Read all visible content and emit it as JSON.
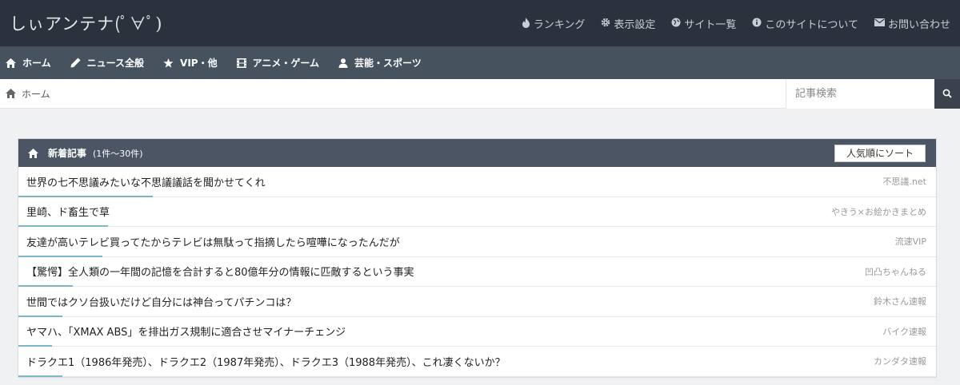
{
  "header": {
    "logo": "しぃアンテナ(ﾟ∀ﾟ)",
    "links": [
      {
        "label": "ランキング",
        "icon": "fire-icon"
      },
      {
        "label": "表示設定",
        "icon": "gear-icon"
      },
      {
        "label": "サイト一覧",
        "icon": "globe-icon"
      },
      {
        "label": "このサイトについて",
        "icon": "info-icon"
      },
      {
        "label": "お問い合わせ",
        "icon": "mail-icon"
      }
    ]
  },
  "nav": {
    "items": [
      {
        "label": "ホーム",
        "icon": "home-icon"
      },
      {
        "label": "ニュース全般",
        "icon": "pencil-icon"
      },
      {
        "label": "VIP・他",
        "icon": "star-icon"
      },
      {
        "label": "アニメ・ゲーム",
        "icon": "film-icon"
      },
      {
        "label": "芸能・スポーツ",
        "icon": "user-icon"
      }
    ]
  },
  "breadcrumb": {
    "home": "ホーム"
  },
  "search": {
    "placeholder": "記事検索"
  },
  "panel": {
    "title": "新着記事",
    "range": "(1件～30件)",
    "sort_label": "人気順にソート"
  },
  "articles": [
    {
      "title": "世界の七不思議みたいな不思議議話を聞かせてくれ",
      "site": "不思議.net"
    },
    {
      "title": "里崎、ド畜生で草",
      "site": "やきう×お絵かきまとめ"
    },
    {
      "title": "友達が高いテレビ買ってたからテレビは無駄って指摘したら喧嘩になったんだが",
      "site": "流速VIP"
    },
    {
      "title": "【驚愕】全人類の一年間の記憶を合計すると80億年分の情報に匹敵するという事実",
      "site": "凹凸ちゃんねる"
    },
    {
      "title": "世間ではクソ台扱いだけど自分には神台ってパチンコは？",
      "site": "鈴木さん速報"
    },
    {
      "title": "ヤマハ、「XMAX ABS」を排出ガス規制に適合させマイナーチェンジ",
      "site": "バイク速報"
    },
    {
      "title": "ドラクエ1（1986年発売）、ドラクエ2（1987年発売）、ドラクエ3（1988年発売）、これ凄くないか？",
      "site": "カンダタ速報"
    }
  ],
  "colors": {
    "topbar": "#2b323d",
    "navbar": "#47525f",
    "panel_head": "#4b5563",
    "underline": "#7eb6c8"
  }
}
